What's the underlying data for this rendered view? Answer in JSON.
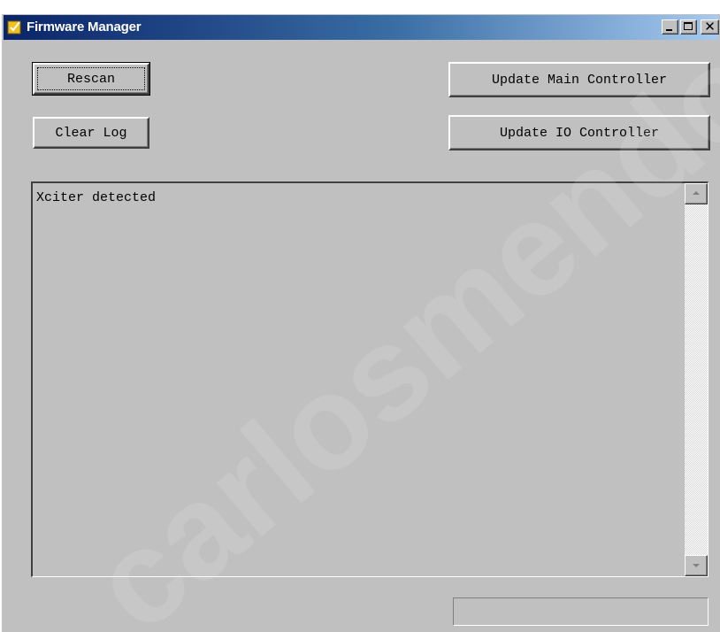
{
  "window": {
    "title": "Firmware Manager",
    "controls": [
      "minimize-icon",
      "maximize-icon",
      "close-icon"
    ],
    "close_glyph": "✕"
  },
  "buttons": {
    "rescan": "Rescan",
    "clear_log": "Clear Log",
    "update_main": "Update Main Controller",
    "update_io": "Update IO Controller"
  },
  "log": {
    "lines": [
      "Xciter detected"
    ]
  },
  "status_field": {
    "value": ""
  },
  "colors": {
    "face": "#c0c0c0",
    "title_start": "#0a246a",
    "title_end": "#a6caf0"
  },
  "watermark": "carlosmendoza"
}
